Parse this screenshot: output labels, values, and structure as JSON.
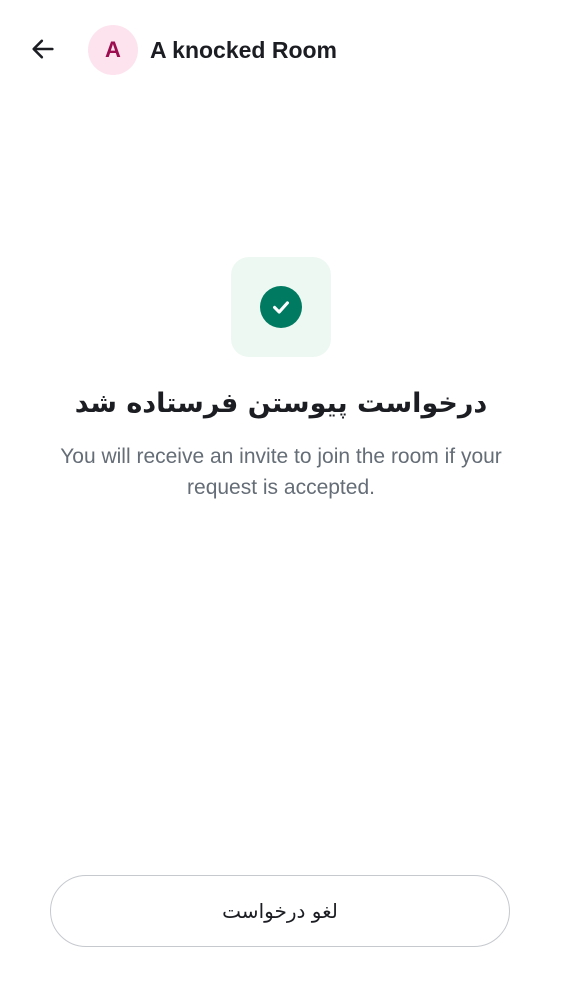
{
  "colors": {
    "text_primary": "#1b1d22",
    "text_secondary": "#656d77",
    "avatar_bg": "#fde3ee",
    "avatar_text": "#9b0d4f",
    "tile_bg": "#edf8f2",
    "success": "#007a61",
    "button_border": "#c6c9ce"
  },
  "header": {
    "back_icon": "arrow-left-icon",
    "avatar_letter": "A",
    "title": "A knocked Room"
  },
  "status": {
    "icon": "check-circle-icon",
    "heading": "درخواست پیوستن فرستاده شد",
    "description": "You will receive an invite to join the room if your request is accepted."
  },
  "actions": {
    "cancel_label": "لغو درخواست"
  }
}
